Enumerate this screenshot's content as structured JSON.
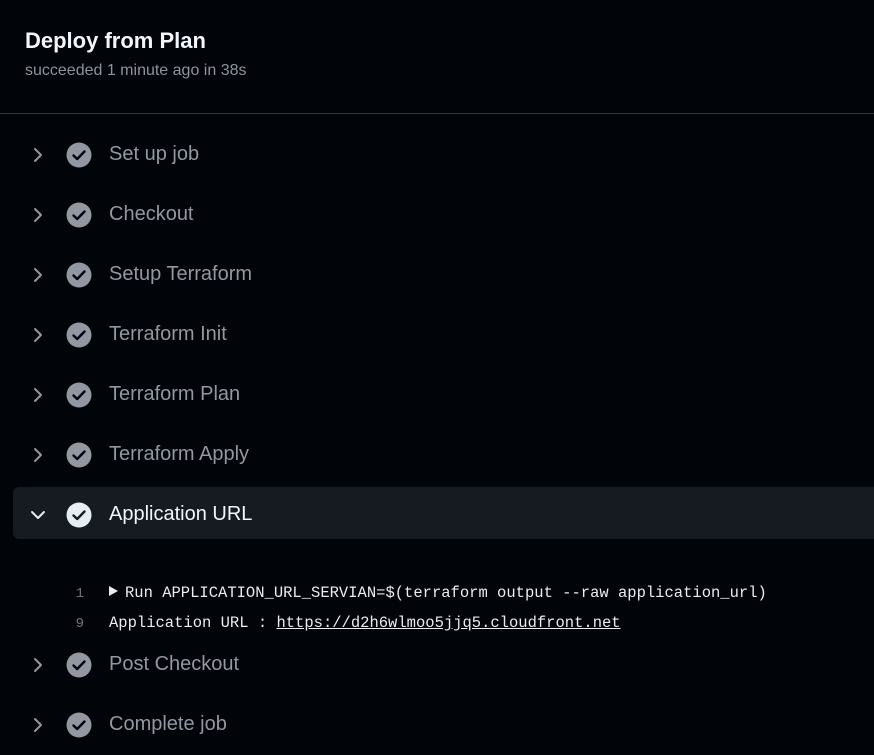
{
  "job": {
    "title": "Deploy from Plan",
    "status": "succeeded 1 minute ago in 38s"
  },
  "steps_before": [
    {
      "label": "Set up job",
      "status": "success"
    },
    {
      "label": "Checkout",
      "status": "success"
    },
    {
      "label": "Setup Terraform",
      "status": "success"
    },
    {
      "label": "Terraform Init",
      "status": "success"
    },
    {
      "label": "Terraform Plan",
      "status": "success"
    },
    {
      "label": "Terraform Apply",
      "status": "success"
    }
  ],
  "expanded_step": {
    "label": "Application URL",
    "status": "success",
    "log": [
      {
        "line": "1",
        "prefix": "",
        "text": "Run APPLICATION_URL_SERVIAN=$(terraform output --raw application_url)"
      },
      {
        "line": "9",
        "prefix": "Application URL : ",
        "link": "https://d2h6wlmoo5jjq5.cloudfront.net"
      }
    ]
  },
  "steps_after": [
    {
      "label": "Post Checkout",
      "status": "success"
    },
    {
      "label": "Complete job",
      "status": "success"
    }
  ],
  "icons": {
    "collapsed": "chevron-right-icon",
    "expanded": "chevron-down-icon",
    "status": "check-circle-icon"
  },
  "colors": {
    "background": "#010409",
    "expanded_row": "#161b22",
    "check_fill": "#9198a1"
  }
}
